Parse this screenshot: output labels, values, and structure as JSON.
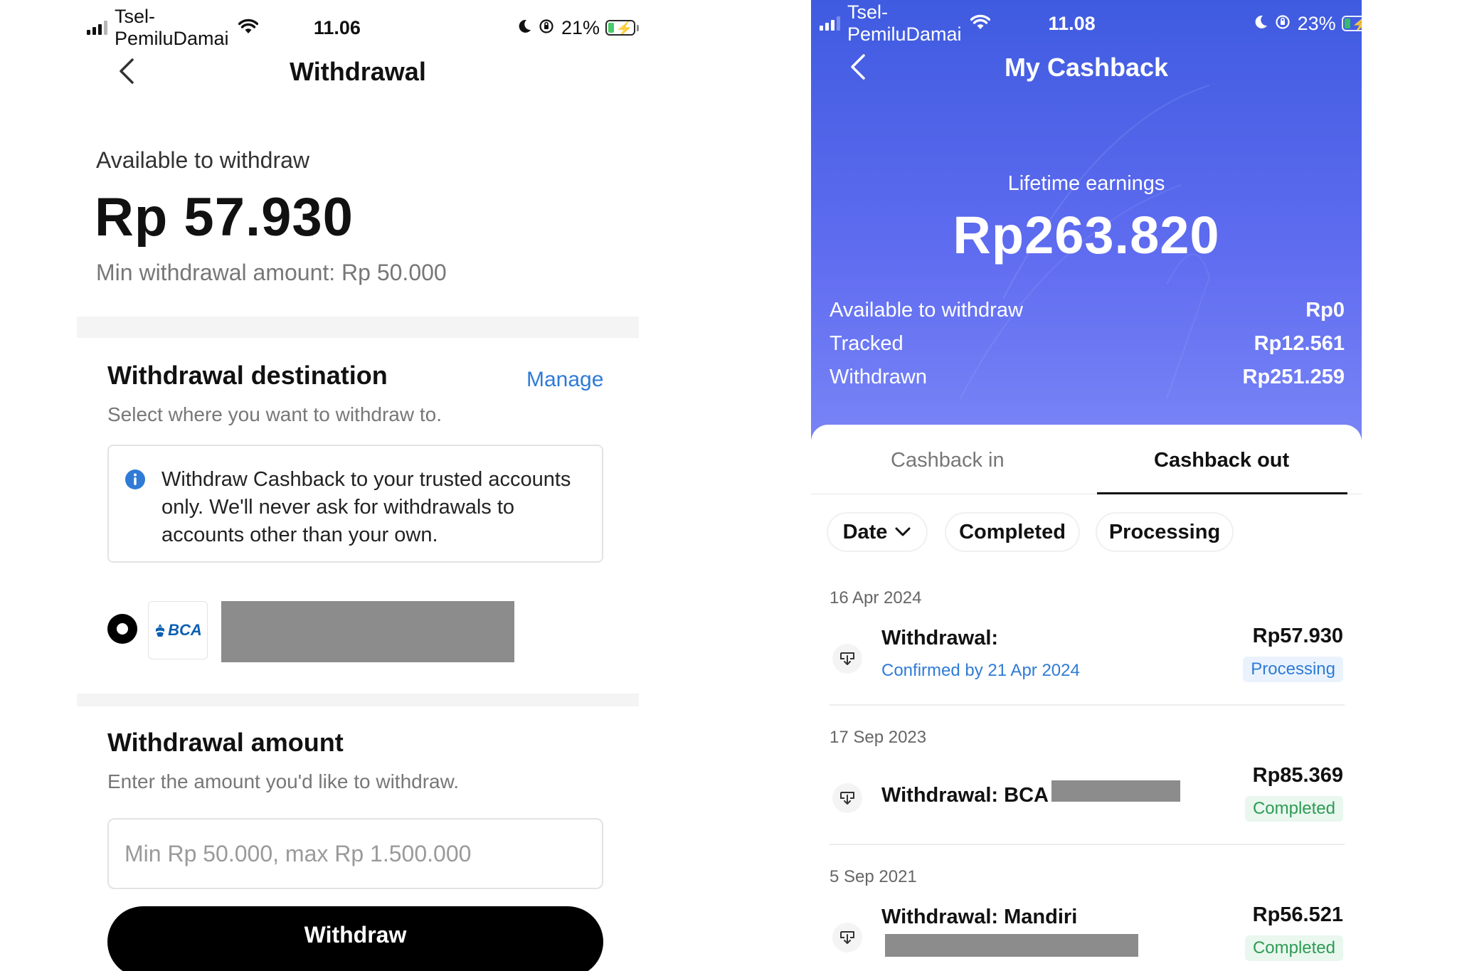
{
  "left_screen": {
    "status_bar": {
      "carrier": "Tsel-PemiluDamai",
      "time": "11.06",
      "battery": "21%",
      "battery_level": 0.21
    },
    "title": "Withdrawal",
    "available_label": "Available to withdraw",
    "available_amount": "Rp 57.930",
    "min_note": "Min withdrawal amount: Rp 50.000",
    "destination": {
      "title": "Withdrawal destination",
      "manage_label": "Manage",
      "subtitle": "Select where you want to withdraw to.",
      "info_text": "Withdraw Cashback to your trusted accounts only. We'll never ask for withdrawals to accounts other than your own.",
      "bank_name": "BCA"
    },
    "amount": {
      "title": "Withdrawal amount",
      "subtitle": "Enter the amount you'd like to withdraw.",
      "placeholder": "Min Rp 50.000, max Rp 1.500.000",
      "value": ""
    },
    "withdraw_button": "Withdraw"
  },
  "right_screen": {
    "status_bar": {
      "carrier": "Tsel-PemiluDamai",
      "time": "11.08",
      "battery": "23%",
      "battery_level": 0.23
    },
    "title": "My Cashback",
    "lifetime_label": "Lifetime earnings",
    "lifetime_amount": "Rp263.820",
    "stats": [
      {
        "label": "Available to withdraw",
        "value": "Rp0"
      },
      {
        "label": "Tracked",
        "value": "Rp12.561"
      },
      {
        "label": "Withdrawn",
        "value": "Rp251.259"
      }
    ],
    "tabs": [
      {
        "label": "Cashback in",
        "active": false
      },
      {
        "label": "Cashback out",
        "active": true
      }
    ],
    "filters": [
      {
        "label": "Date"
      },
      {
        "label": "Completed"
      },
      {
        "label": "Processing"
      }
    ],
    "transactions": [
      {
        "date": "16 Apr 2024",
        "title": "Withdrawal:",
        "subtitle": "Confirmed by 21 Apr 2024",
        "amount": "Rp57.930",
        "status": "Processing"
      },
      {
        "date": "17 Sep 2023",
        "title": "Withdrawal: BCA",
        "subtitle": "",
        "amount": "Rp85.369",
        "status": "Completed"
      },
      {
        "date": "5 Sep 2021",
        "title": "Withdrawal: Mandiri",
        "subtitle": "",
        "amount": "Rp56.521",
        "status": "Completed"
      }
    ]
  },
  "colors": {
    "accent_blue": "#2f7bd6",
    "hero_gradient_top": "#3f5be0",
    "hero_gradient_bottom": "#7a86f6",
    "completed_green": "#2e9b54",
    "redaction_gray": "#8c8c8c"
  },
  "icons": [
    "cellular-signal-icon",
    "wifi-icon",
    "moon-icon",
    "orientation-lock-icon",
    "battery-charging-icon",
    "back-chevron-icon",
    "info-icon",
    "chevron-down-icon",
    "withdrawal-icon"
  ]
}
